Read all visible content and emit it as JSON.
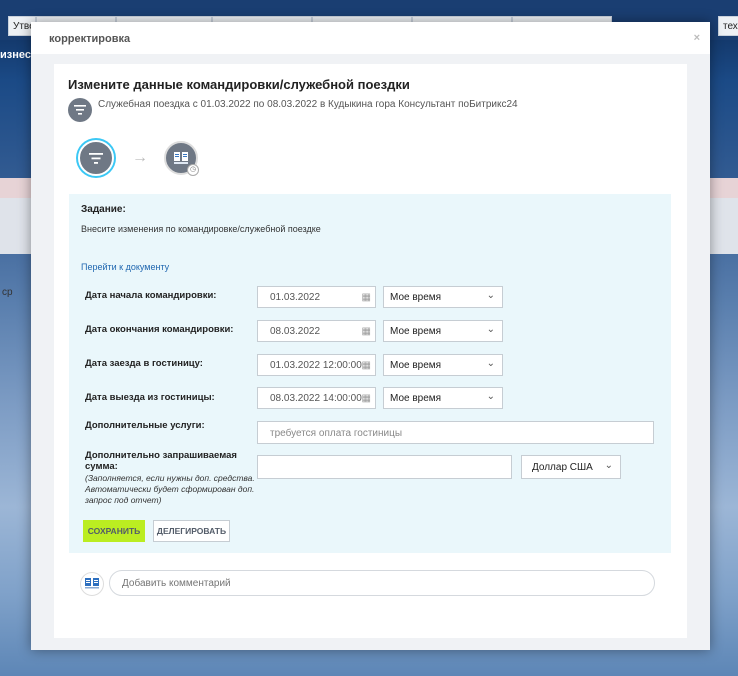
{
  "background": {
    "tabs": [
      "Утве",
      "",
      "",
      "",
      "",
      "",
      "",
      "техн"
    ],
    "side_text": "изнес-п",
    "side_label": "ср"
  },
  "modal": {
    "title": "корректировка",
    "close": "×"
  },
  "panel": {
    "title": "Измените данные командировки/служебной поездки",
    "trip_desc": "Служебная поездка с 01.03.2022 по 08.03.2022 в Кудыкина гора Консультант поБитрикс24",
    "arrow": "→"
  },
  "task": {
    "label": "Задание:",
    "text": "Внесите изменения по командировке/служебной поездке",
    "doc_link": "Перейти к документу"
  },
  "fields": {
    "start": {
      "label": "Дата начала командировки:",
      "value": "01.03.2022",
      "tz": "Мое время"
    },
    "end": {
      "label": "Дата окончания командировки:",
      "value": "08.03.2022",
      "tz": "Мое время"
    },
    "checkin": {
      "label": "Дата заезда в гостиницу:",
      "value": "01.03.2022 12:00:00",
      "tz": "Мое время"
    },
    "checkout": {
      "label": "Дата выезда из гостиницы:",
      "value": "08.03.2022 14:00:00",
      "tz": "Мое время"
    },
    "services": {
      "label": "Дополнительные услуги:",
      "value": "требуется оплата гостиницы"
    },
    "amount": {
      "label": "Дополнительно запрашиваемая сумма:",
      "note": "(Заполняется, если нужны доп. средства. Автоматически будет сформирован доп. запрос под отчет)",
      "value": "",
      "currency": "Доллар США"
    }
  },
  "buttons": {
    "save": "СОХРАНИТЬ",
    "delegate": "ДЕЛЕГИРОВАТЬ"
  },
  "comment": {
    "placeholder": "Добавить комментарий"
  }
}
